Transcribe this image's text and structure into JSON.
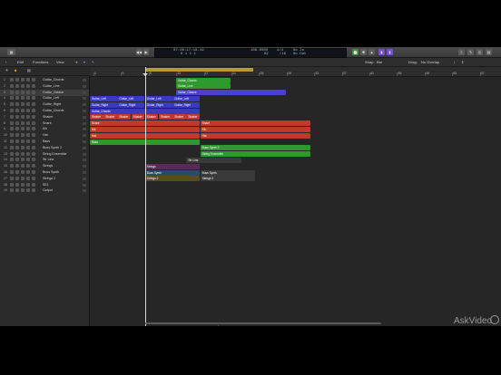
{
  "app": {
    "title": "Logic Pro X"
  },
  "control_bar": {
    "position": "0 1 1 1",
    "position_top": "07:00:17:18.19",
    "tempo": "108.0000",
    "time_sig": "4/4",
    "key": "/16",
    "in_label": "No In",
    "out_label": "No Out",
    "cpu_label": "BZ"
  },
  "menu": {
    "edit": "Edit",
    "functions": "Functions",
    "view": "View",
    "snap_label": "Snap:",
    "snap_value": "Bar",
    "drag_label": "Drag:",
    "drag_value": "No Overlap"
  },
  "ruler": {
    "bars": [
      "1",
      "5",
      "9",
      "13",
      "17",
      "21",
      "25",
      "29",
      "33",
      "37",
      "41",
      "45",
      "49",
      "53",
      "57"
    ]
  },
  "tracks": [
    {
      "n": "1",
      "name": "Guitar_Chords"
    },
    {
      "n": "2",
      "name": "Guitar_Line"
    },
    {
      "n": "3",
      "name": "Guitar_Octave"
    },
    {
      "n": "4",
      "name": "Guitar_Left"
    },
    {
      "n": "5",
      "name": "Guitar_Right"
    },
    {
      "n": "6",
      "name": "Guitar_Chords"
    },
    {
      "n": "7",
      "name": "Shaker"
    },
    {
      "n": "8",
      "name": "Snare"
    },
    {
      "n": "9",
      "name": "Kik"
    },
    {
      "n": "10",
      "name": "Hat"
    },
    {
      "n": "11",
      "name": "Bass"
    },
    {
      "n": "12",
      "name": "Buss Synth 2"
    },
    {
      "n": "13",
      "name": "String Ensemble"
    },
    {
      "n": "14",
      "name": "Str Line"
    },
    {
      "n": "15",
      "name": "Strings"
    },
    {
      "n": "16",
      "name": "Buss Synth"
    },
    {
      "n": "17",
      "name": "Strings 2"
    },
    {
      "n": "18",
      "name": "SE1"
    },
    {
      "n": "19",
      "name": "Output"
    }
  ],
  "regions": [
    {
      "track": 0,
      "start": 13.5,
      "len": 8,
      "label": "Guitar_Chords",
      "color": "#2e9a2e"
    },
    {
      "track": 1,
      "start": 13.5,
      "len": 8,
      "label": "Guitar_Line",
      "color": "#2e9a2e"
    },
    {
      "track": 2,
      "start": 13.5,
      "len": 16,
      "label": "Guitar_Octave",
      "color": "#4a3fd0"
    },
    {
      "track": 3,
      "start": 1,
      "len": 4,
      "label": "Guitar_Left",
      "color": "#3a3abf"
    },
    {
      "track": 3,
      "start": 5,
      "len": 4,
      "label": "Guitar_Left",
      "color": "#3a3abf"
    },
    {
      "track": 3,
      "start": 9,
      "len": 4,
      "label": "Guitar_Left",
      "color": "#3a3abf"
    },
    {
      "track": 3,
      "start": 13,
      "len": 4,
      "label": "Guitar_Left",
      "color": "#3a3abf"
    },
    {
      "track": 4,
      "start": 1,
      "len": 4,
      "label": "Guitar_Right",
      "color": "#3a3abf"
    },
    {
      "track": 4,
      "start": 5,
      "len": 4,
      "label": "Guitar_Right",
      "color": "#3a3abf"
    },
    {
      "track": 4,
      "start": 9,
      "len": 4,
      "label": "Guitar_Right",
      "color": "#3a3abf"
    },
    {
      "track": 4,
      "start": 13,
      "len": 4,
      "label": "Guitar_Right",
      "color": "#3a3abf"
    },
    {
      "track": 5,
      "start": 1,
      "len": 16,
      "label": "Guitar_Chords",
      "color": "#3a3abf"
    },
    {
      "track": 6,
      "start": 1,
      "len": 2,
      "label": "Shaker",
      "color": "#c0392b"
    },
    {
      "track": 6,
      "start": 3,
      "len": 2,
      "label": "Shaker",
      "color": "#c0392b"
    },
    {
      "track": 6,
      "start": 5,
      "len": 2,
      "label": "Shaker",
      "color": "#c0392b"
    },
    {
      "track": 6,
      "start": 7,
      "len": 2,
      "label": "Shaker",
      "color": "#c0392b"
    },
    {
      "track": 6,
      "start": 9,
      "len": 2,
      "label": "Shaker",
      "color": "#c0392b"
    },
    {
      "track": 6,
      "start": 11,
      "len": 2,
      "label": "Shaker",
      "color": "#c0392b"
    },
    {
      "track": 6,
      "start": 13,
      "len": 2,
      "label": "Shaker",
      "color": "#c0392b"
    },
    {
      "track": 6,
      "start": 15,
      "len": 2,
      "label": "Shaker",
      "color": "#c0392b"
    },
    {
      "track": 7,
      "start": 1,
      "len": 16,
      "label": "Snare",
      "color": "#c0392b"
    },
    {
      "track": 7,
      "start": 17,
      "len": 16,
      "label": "Snare",
      "color": "#c0392b"
    },
    {
      "track": 8,
      "start": 1,
      "len": 16,
      "label": "Kik",
      "color": "#c0392b"
    },
    {
      "track": 8,
      "start": 17,
      "len": 16,
      "label": "Kik",
      "color": "#c0392b"
    },
    {
      "track": 9,
      "start": 1,
      "len": 16,
      "label": "Hat",
      "color": "#c0392b"
    },
    {
      "track": 9,
      "start": 17,
      "len": 16,
      "label": "Hat",
      "color": "#c0392b"
    },
    {
      "track": 10,
      "start": 1,
      "len": 16,
      "label": "Bass",
      "color": "#2e9a2e"
    },
    {
      "track": 11,
      "start": 17,
      "len": 16,
      "label": "Buss Synth 2",
      "color": "#2e9a2e"
    },
    {
      "track": 12,
      "start": 17,
      "len": 16,
      "label": "String Ensemble",
      "color": "#2e9a2e"
    },
    {
      "track": 13,
      "start": 15,
      "len": 8,
      "label": "Str Line",
      "color": "#3a3a3a"
    },
    {
      "track": 14,
      "start": 9,
      "len": 8,
      "label": "Strings",
      "color": "#5a2a5a"
    },
    {
      "track": 15,
      "start": 9,
      "len": 8,
      "label": "Buss Synth",
      "color": "#2a4a6a"
    },
    {
      "track": 15,
      "start": 17,
      "len": 8,
      "label": "Buss Synth",
      "color": "#3a3a3a"
    },
    {
      "track": 16,
      "start": 9,
      "len": 8,
      "label": "Strings 2",
      "color": "#5a4a20"
    },
    {
      "track": 16,
      "start": 17,
      "len": 8,
      "label": "Strings 2",
      "color": "#3a3a3a"
    }
  ],
  "watermark": {
    "text": "AskVideo"
  }
}
